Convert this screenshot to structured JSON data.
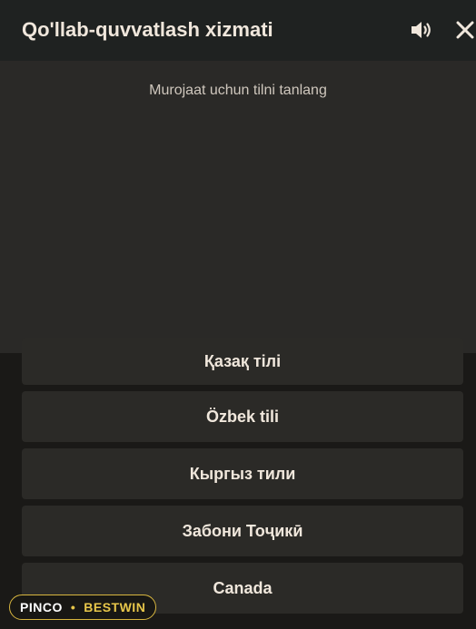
{
  "header": {
    "title": "Qo'llab-quvvatlash xizmati",
    "sound_icon": "speaker-volume-icon",
    "close_icon": "close-icon"
  },
  "chat": {
    "prompt": "Murojaat uchun tilni tanlang"
  },
  "language_options": [
    {
      "label": "Қазақ тілі"
    },
    {
      "label": "Özbek tili"
    },
    {
      "label": "Кыргыз тили"
    },
    {
      "label": "Забони Тоҷикӣ"
    },
    {
      "label": "Canada"
    }
  ],
  "badge": {
    "left": "PINCO",
    "separator": "•",
    "right": "BESTWIN"
  },
  "colors": {
    "header_bg": "#1f2221",
    "panel_bg": "#2a2927",
    "button_bg": "#2b2a27",
    "text": "#f0e7dc",
    "badge_accent": "#e7c64a"
  }
}
